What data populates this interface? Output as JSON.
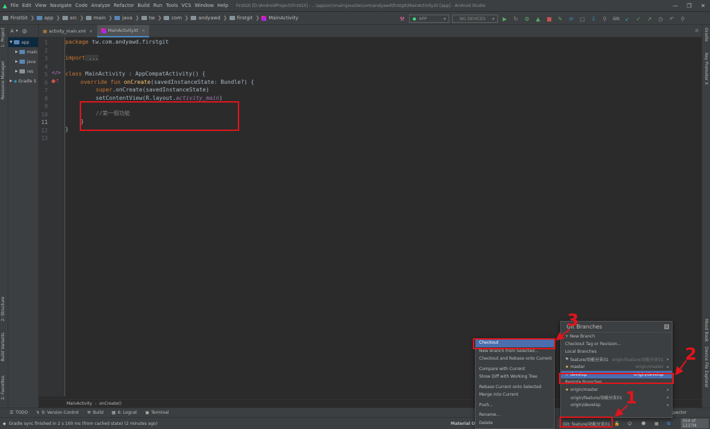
{
  "menu": [
    "File",
    "Edit",
    "View",
    "Navigate",
    "Code",
    "Analyze",
    "Refactor",
    "Build",
    "Run",
    "Tools",
    "VCS",
    "Window",
    "Help"
  ],
  "window_title": "FirstGit [D:\\AndroidProject\\FirstGit] - ...\\app\\src\\main\\java\\tw\\com\\andyawd\\firstgit\\MainActivity.kt [app] - Android Studio",
  "breadcrumbs": [
    "FirstGit",
    "app",
    "src",
    "main",
    "java",
    "tw",
    "com",
    "andyawd",
    "firstgit",
    "MainActivity"
  ],
  "toolbar": {
    "run_config": "APP",
    "device": "NO DEVICES",
    "git_label": "Git:"
  },
  "project_panel": {
    "title": "A",
    "items": [
      "app",
      "main",
      "java",
      "res",
      "Gradle S"
    ]
  },
  "tabs": [
    {
      "label": "activity_main.xml",
      "active": false
    },
    {
      "label": "MainActivity.kt",
      "active": true
    }
  ],
  "editor": {
    "line_numbers": [
      "1",
      "2",
      "3",
      "4",
      "5",
      "6",
      "7",
      "8",
      "9",
      "10",
      "11",
      "12",
      "13"
    ],
    "line1": {
      "kw": "package",
      "text": " tw.com.andyawd.firstgit"
    },
    "line3": {
      "kw": "import",
      "rest": " ..."
    },
    "line6": {
      "kw": "class",
      "text": " MainActivity : AppCompatActivity() {"
    },
    "line7": {
      "kw1": "override",
      "kw2": " fun",
      "fn": " onCreate",
      "text": "(savedInstanceState: Bundle?) {"
    },
    "line8": {
      "kw": "super",
      "text": ".onCreate(savedInstanceState)"
    },
    "line9": {
      "text": "setContentView(R.layout.",
      "it": "activity_main",
      "end": ")"
    },
    "line11": {
      "comment": "//第一個功能"
    },
    "line12": {
      "text": "}"
    },
    "line13": {
      "text": "}"
    },
    "footer": [
      "MainActivity",
      "onCreate()"
    ]
  },
  "bottom_tools": [
    "TODO",
    "9: Version Control",
    "Build",
    "6: Logcat",
    "Terminal"
  ],
  "bottom_tools_right": "Layout Inspector",
  "status": {
    "message": "Gradle sync finished in 2 s 100 ms (from cached state) (2 minutes ago)",
    "theme": "Material Oce",
    "git_branch": "Git: feature/功能分支01",
    "memory": "354 of 1237M"
  },
  "left_tools": [
    "1: Project",
    "Resource Manager",
    "2: Structure",
    "Build Variants",
    "2: Favorites"
  ],
  "right_tools": [
    "Gradle",
    "Key Promoter X",
    "Mood Book",
    "Device File Explorer"
  ],
  "branch_popup": {
    "title": "Git Branches",
    "new_branch": "+ New Branch",
    "checkout_tag": "Checkout Tag or Revision...",
    "local_header": "Local Branches",
    "local": [
      {
        "name": "feature/功能分支01",
        "tracking": "origin/feature/功能分支01"
      },
      {
        "name": "master",
        "tracking": "origin/master"
      },
      {
        "name": "develop",
        "tracking": "origin/develop"
      }
    ],
    "remote_header": "Remote Branches",
    "remote": [
      "origin/master",
      "origin/feature/功能分支01",
      "origin/develop"
    ]
  },
  "context_menu": {
    "items": [
      "Checkout",
      "New Branch from Selected...",
      "Checkout and Rebase onto Current",
      "Compare with Current",
      "Show Diff with Working Tree",
      "Rebase Current onto Selected",
      "Merge into Current",
      "Push...",
      "Rename...",
      "Delete"
    ]
  },
  "annotations": [
    "1",
    "2",
    "3"
  ],
  "colors": {
    "annotation_red": "#e0151b",
    "selection_blue": "#4b6eaf"
  }
}
